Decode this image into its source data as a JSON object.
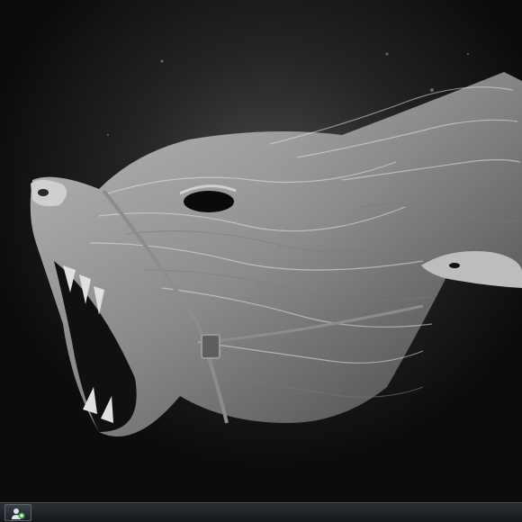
{
  "desktop": {
    "wallpaper_subject": "wolf-head-wallpaper"
  },
  "taskbar": {
    "start_button_icon": "start-orb-icon",
    "accent_color": "#3aa63a"
  }
}
